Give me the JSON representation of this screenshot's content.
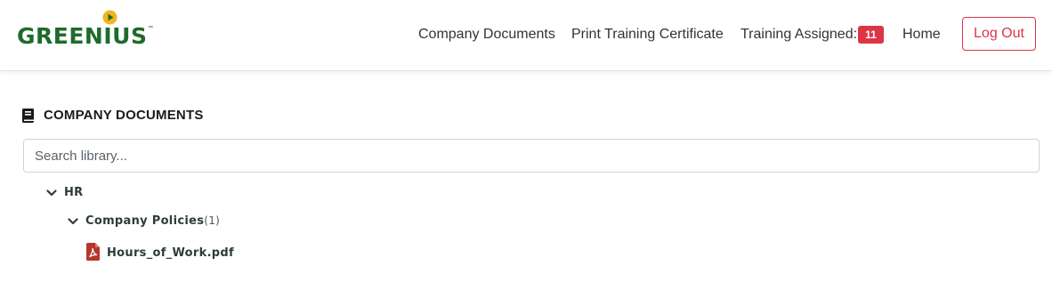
{
  "brand": {
    "name": "GREENIUS",
    "trademark": "™",
    "colors": {
      "text": "#1e6b2c",
      "play": "#f2b51c"
    }
  },
  "nav": {
    "company_documents": "Company Documents",
    "print_certificate": "Print Training Certificate",
    "training_assigned": "Training Assigned:",
    "training_assigned_count": "11",
    "home": "Home",
    "logout": "Log Out"
  },
  "main": {
    "section_title": "COMPANY DOCUMENTS",
    "section_icon": "book-icon",
    "search_placeholder": "Search library...",
    "tree": {
      "root": {
        "label": "HR",
        "expanded": true
      },
      "folder": {
        "label": "Company Policies",
        "count": "(1)",
        "expanded": true
      },
      "file": {
        "label": "Hours_of_Work.pdf",
        "icon": "pdf-icon"
      }
    }
  },
  "colors": {
    "danger": "#dc3545",
    "pdf": "#b5372c",
    "tree_text": "#2f3b3b"
  }
}
